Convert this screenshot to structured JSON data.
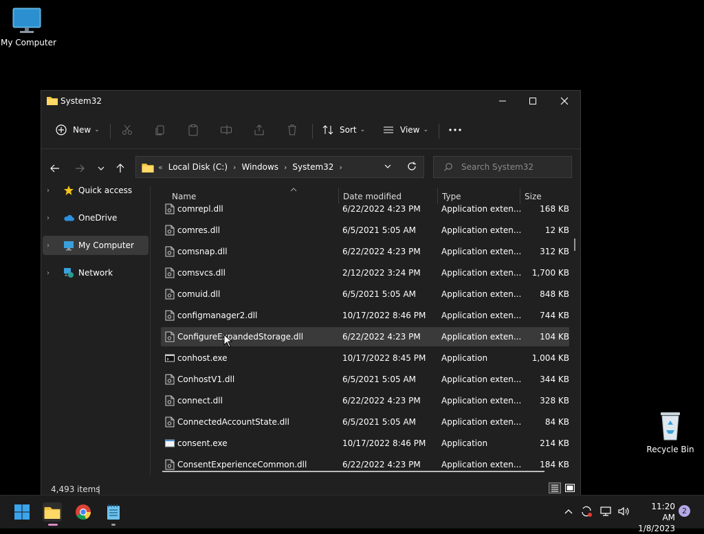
{
  "desktop": {
    "my_computer_label": "My Computer",
    "recycle_bin_label": "Recycle Bin"
  },
  "window": {
    "title": "System32"
  },
  "toolbar": {
    "new_label": "New",
    "sort_label": "Sort",
    "view_label": "View"
  },
  "address": {
    "crumbs": [
      "Local Disk (C:)",
      "Windows",
      "System32"
    ],
    "search_placeholder": "Search System32"
  },
  "sidebar": {
    "items": [
      {
        "label": "Quick access"
      },
      {
        "label": "OneDrive"
      },
      {
        "label": "My Computer"
      },
      {
        "label": "Network"
      }
    ]
  },
  "columns": {
    "name": "Name",
    "date": "Date modified",
    "type": "Type",
    "size": "Size"
  },
  "files": [
    {
      "name": "comrepl.dll",
      "date": "6/22/2022 4:23 PM",
      "type": "Application exten...",
      "size": "168 KB"
    },
    {
      "name": "comres.dll",
      "date": "6/5/2021 5:05 AM",
      "type": "Application exten...",
      "size": "12 KB"
    },
    {
      "name": "comsnap.dll",
      "date": "6/22/2022 4:23 PM",
      "type": "Application exten...",
      "size": "312 KB"
    },
    {
      "name": "comsvcs.dll",
      "date": "2/12/2022 3:24 PM",
      "type": "Application exten...",
      "size": "1,700 KB"
    },
    {
      "name": "comuid.dll",
      "date": "6/5/2021 5:05 AM",
      "type": "Application exten...",
      "size": "848 KB"
    },
    {
      "name": "configmanager2.dll",
      "date": "10/17/2022 8:46 PM",
      "type": "Application exten...",
      "size": "744 KB"
    },
    {
      "name": "ConfigureExpandedStorage.dll",
      "date": "6/22/2022 4:23 PM",
      "type": "Application exten...",
      "size": "104 KB"
    },
    {
      "name": "conhost.exe",
      "date": "10/17/2022 8:45 PM",
      "type": "Application",
      "size": "1,004 KB"
    },
    {
      "name": "ConhostV1.dll",
      "date": "6/5/2021 5:05 AM",
      "type": "Application exten...",
      "size": "344 KB"
    },
    {
      "name": "connect.dll",
      "date": "6/22/2022 4:23 PM",
      "type": "Application exten...",
      "size": "328 KB"
    },
    {
      "name": "ConnectedAccountState.dll",
      "date": "6/5/2021 5:05 AM",
      "type": "Application exten...",
      "size": "84 KB"
    },
    {
      "name": "consent.exe",
      "date": "10/17/2022 8:46 PM",
      "type": "Application",
      "size": "214 KB"
    },
    {
      "name": "ConsentExperienceCommon.dll",
      "date": "6/22/2022 4:23 PM",
      "type": "Application exten...",
      "size": "184 KB"
    }
  ],
  "status": {
    "item_count": "4,493 items"
  },
  "clock": {
    "time": "11:20 AM",
    "date": "1/8/2023"
  },
  "notifications": {
    "count": "2"
  }
}
